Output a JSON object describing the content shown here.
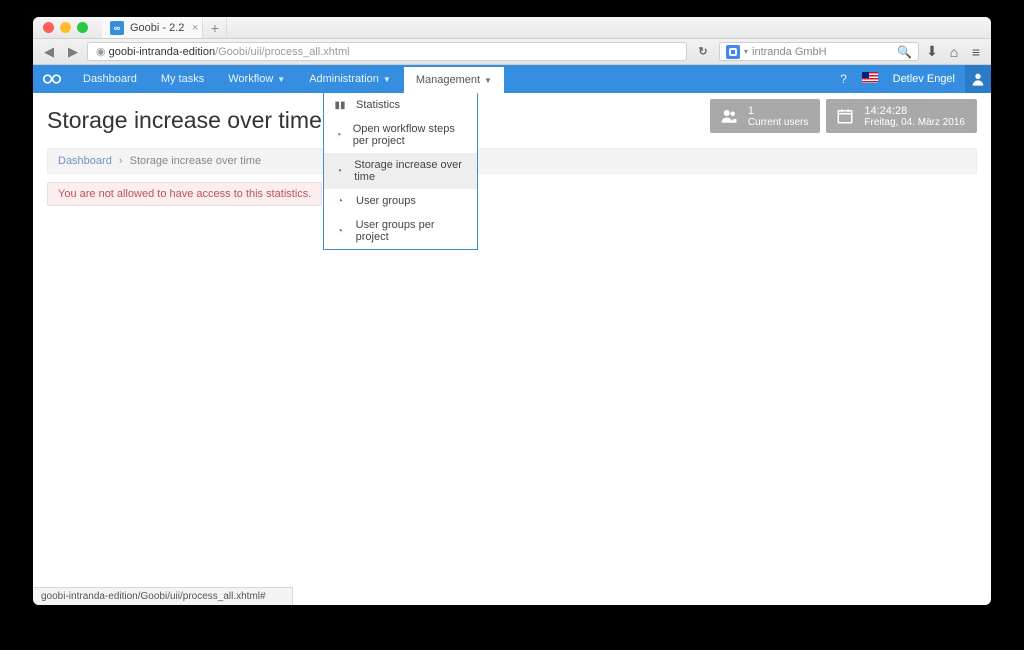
{
  "browser": {
    "tab_title": "Goobi - 2.2",
    "url_host": "goobi-intranda-edition",
    "url_path": "/Goobi/uii/process_all.xhtml",
    "search_placeholder": "intranda GmbH",
    "status_text": "goobi-intranda-edition/Goobi/uii/process_all.xhtml#"
  },
  "nav": {
    "items": [
      "Dashboard",
      "My tasks",
      "Workflow",
      "Administration",
      "Management"
    ],
    "user": "Detlev Engel"
  },
  "dropdown": {
    "items": [
      {
        "label": "Statistics",
        "icon": "bar-chart-icon"
      },
      {
        "label": "Open workflow steps per project",
        "icon": "pie-icon"
      },
      {
        "label": "Storage increase over time",
        "icon": "pie-icon",
        "selected": true
      },
      {
        "label": "User groups",
        "icon": "pie-icon"
      },
      {
        "label": "User groups per project",
        "icon": "pie-icon"
      }
    ]
  },
  "page": {
    "title": "Storage increase over time",
    "breadcrumb_root": "Dashboard",
    "breadcrumb_here": "Storage increase over time",
    "alert": "You are not allowed to have access to this statistics."
  },
  "cards": {
    "users_count": "1",
    "users_label": "Current users",
    "time": "14:24:28",
    "date": "Freitag, 04. März 2016"
  }
}
